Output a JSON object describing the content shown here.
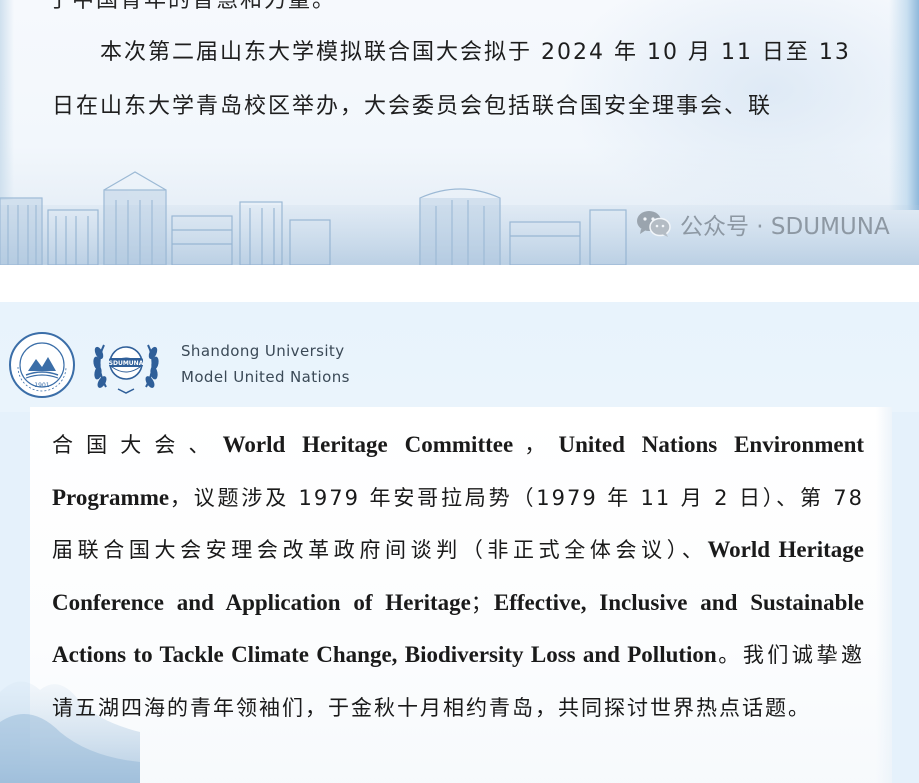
{
  "top_section": {
    "partial_line": "于中国青年的智慧和力量。",
    "line1": "本次第二届山东大学模拟联合国大会拟于 2024 年 10 月 11 日至 13",
    "line2": "日在山东大学青岛校区举办，大会委员会包括联合国安全理事会、联",
    "watermark": "公众号 · SDUMUNA"
  },
  "header": {
    "org_line1": "Shandong University",
    "org_line2": "Model United Nations",
    "mun_logo_text": "SDUMUNA",
    "sdu_logo_year": "1901"
  },
  "body": {
    "segments": [
      {
        "type": "cn",
        "text": "合国大会、"
      },
      {
        "type": "en",
        "text": "World Heritage Committee"
      },
      {
        "type": "cn",
        "text": "，"
      },
      {
        "type": "en",
        "text": "United Nations Environment Programme"
      },
      {
        "type": "cn",
        "text": "，议题涉及 1979 年安哥拉局势（1979 年 11 月 2 日）、第 78 届联合国大会安理会改革政府间谈判（非正式全体会议）、"
      },
      {
        "type": "en",
        "text": "World Heritage Conference and Application of Heritage"
      },
      {
        "type": "cn",
        "text": "；"
      },
      {
        "type": "en",
        "text": "Effective, Inclusive and Sustainable Actions to Tackle Climate Change, Biodiversity Loss and Pollution"
      },
      {
        "type": "cn",
        "text": "。我们诚挚邀请五湖四海的青年领袖们，于金秋十月相约青岛，共同探讨世界热点话题。"
      }
    ]
  },
  "colors": {
    "text": "#1a1a1a",
    "panel_bg": "#e5f1fb",
    "watermark": "#8d98a3",
    "accent_blue": "#2f6fae"
  }
}
